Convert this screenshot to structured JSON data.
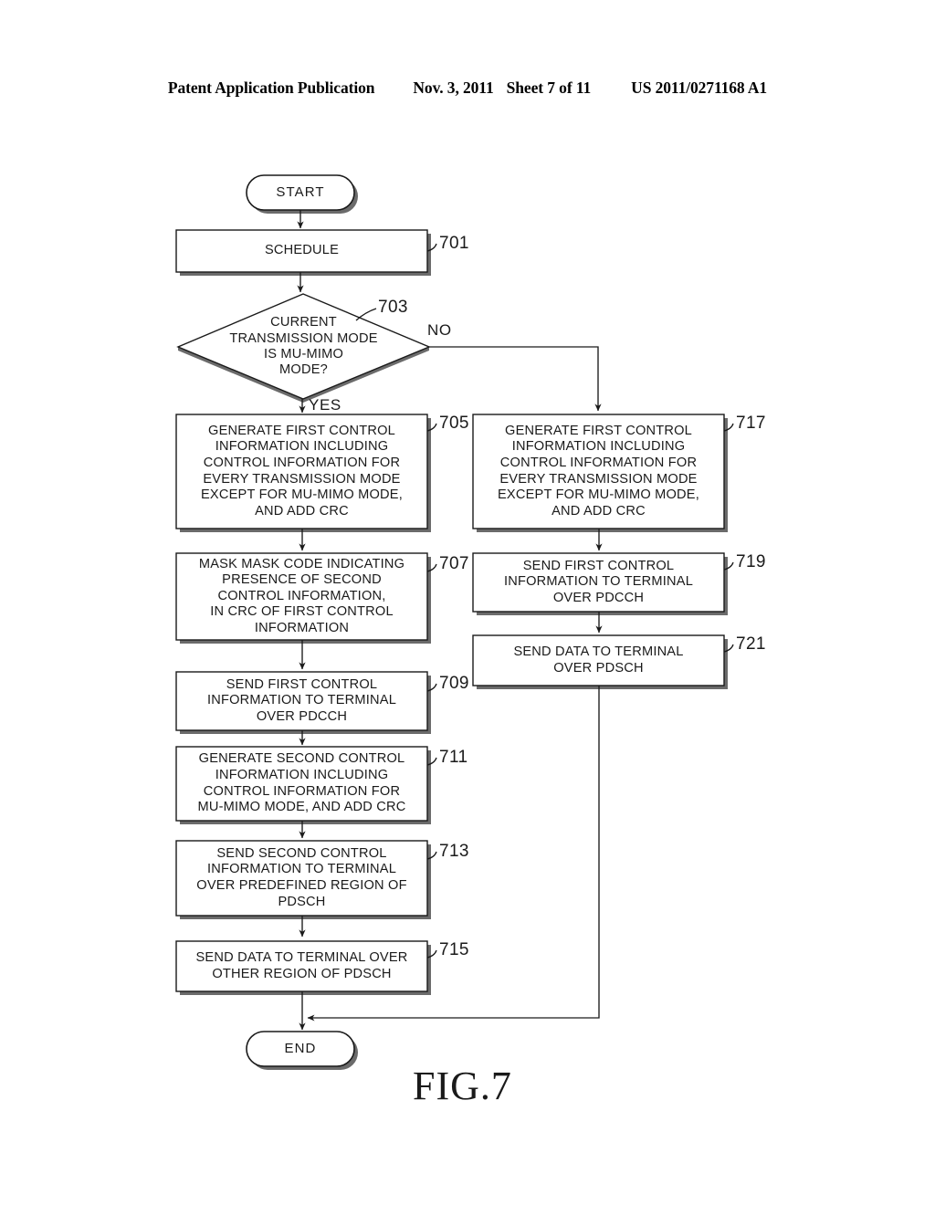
{
  "header": {
    "publication": "Patent Application Publication",
    "date": "Nov. 3, 2011",
    "sheet": "Sheet 7 of 11",
    "number": "US 2011/0271168 A1"
  },
  "figure": {
    "caption": "FIG.7"
  },
  "flowchart": {
    "start": {
      "label": "START"
    },
    "end": {
      "label": "END"
    },
    "branches": {
      "yes": "YES",
      "no": "NO"
    },
    "nodes": [
      {
        "ref": "701",
        "shape": "process",
        "lines": [
          "SCHEDULE"
        ]
      },
      {
        "ref": "703",
        "shape": "decision",
        "lines": [
          "CURRENT",
          "TRANSMISSION MODE",
          "IS MU-MIMO",
          "MODE?"
        ]
      },
      {
        "ref": "705",
        "shape": "process",
        "lines": [
          "GENERATE FIRST CONTROL",
          "INFORMATION INCLUDING",
          "CONTROL INFORMATION FOR",
          "EVERY TRANSMISSION MODE",
          "EXCEPT FOR MU-MIMO MODE,",
          "AND ADD CRC"
        ]
      },
      {
        "ref": "707",
        "shape": "process",
        "lines": [
          "MASK MASK CODE INDICATING",
          "PRESENCE OF SECOND",
          "CONTROL INFORMATION,",
          "IN CRC OF FIRST CONTROL",
          "INFORMATION"
        ]
      },
      {
        "ref": "709",
        "shape": "process",
        "lines": [
          "SEND FIRST CONTROL",
          "INFORMATION TO TERMINAL",
          "OVER PDCCH"
        ]
      },
      {
        "ref": "711",
        "shape": "process",
        "lines": [
          "GENERATE SECOND CONTROL",
          "INFORMATION INCLUDING",
          "CONTROL INFORMATION FOR",
          "MU-MIMO MODE, AND ADD CRC"
        ]
      },
      {
        "ref": "713",
        "shape": "process",
        "lines": [
          "SEND SECOND CONTROL",
          "INFORMATION TO TERMINAL",
          "OVER PREDEFINED REGION OF",
          "PDSCH"
        ]
      },
      {
        "ref": "715",
        "shape": "process",
        "lines": [
          "SEND DATA TO TERMINAL OVER",
          "OTHER REGION OF PDSCH"
        ]
      },
      {
        "ref": "717",
        "shape": "process",
        "lines": [
          "GENERATE FIRST CONTROL",
          "INFORMATION INCLUDING",
          "CONTROL INFORMATION FOR",
          "EVERY TRANSMISSION MODE",
          "EXCEPT FOR MU-MIMO MODE,",
          "AND ADD CRC"
        ]
      },
      {
        "ref": "719",
        "shape": "process",
        "lines": [
          "SEND FIRST CONTROL",
          "INFORMATION TO TERMINAL",
          "OVER PDCCH"
        ]
      },
      {
        "ref": "721",
        "shape": "process",
        "lines": [
          "SEND DATA TO TERMINAL",
          "OVER PDSCH"
        ]
      }
    ]
  },
  "colors": {
    "ink": "#1a1a1a",
    "shadow": "#595959",
    "page": "#ffffff"
  }
}
